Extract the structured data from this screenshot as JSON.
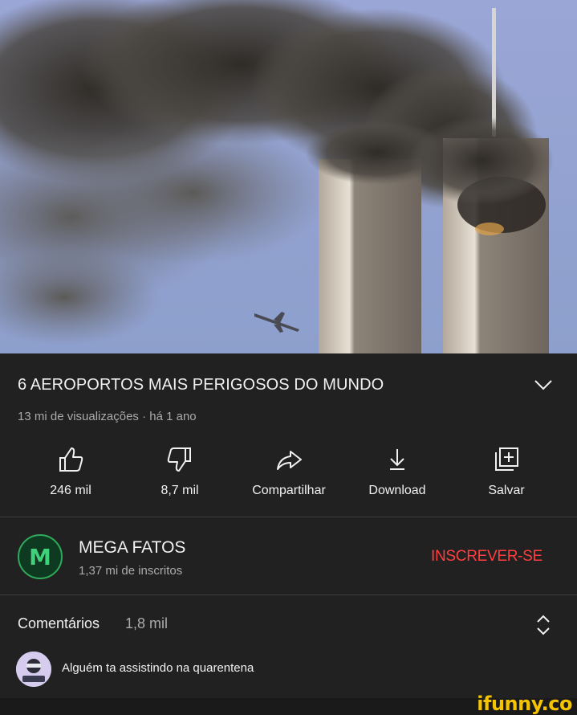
{
  "video": {
    "thumbnail_icon": "video-frame"
  },
  "info": {
    "title": "6 AEROPORTOS MAIS PERIGOSOS DO MUNDO",
    "meta": "13 mi de visualizações · há 1 ano",
    "expand_icon": "chevron-down-icon"
  },
  "actions": [
    {
      "icon": "thumbs-up-icon",
      "label": "246 mil"
    },
    {
      "icon": "thumbs-down-icon",
      "label": "8,7 mil"
    },
    {
      "icon": "share-icon",
      "label": "Compartilhar"
    },
    {
      "icon": "download-icon",
      "label": "Download"
    },
    {
      "icon": "save-playlist-icon",
      "label": "Salvar"
    }
  ],
  "channel": {
    "avatar_letter": "M",
    "name": "MEGA FATOS",
    "subscribers": "1,37 mi de inscritos",
    "subscribe_label": "INSCREVER-SE"
  },
  "comments": {
    "label": "Comentários",
    "count": "1,8 mil",
    "top_comment": "Alguém ta assistindo na quarentena",
    "toggle_icon": "expand-collapse-icon"
  },
  "watermark": "ifunny.co",
  "colors": {
    "background": "#212121",
    "text_primary": "#f1f1f1",
    "text_secondary": "#aaaaaa",
    "subscribe": "#ff3e3e",
    "watermark": "#f5c400"
  }
}
